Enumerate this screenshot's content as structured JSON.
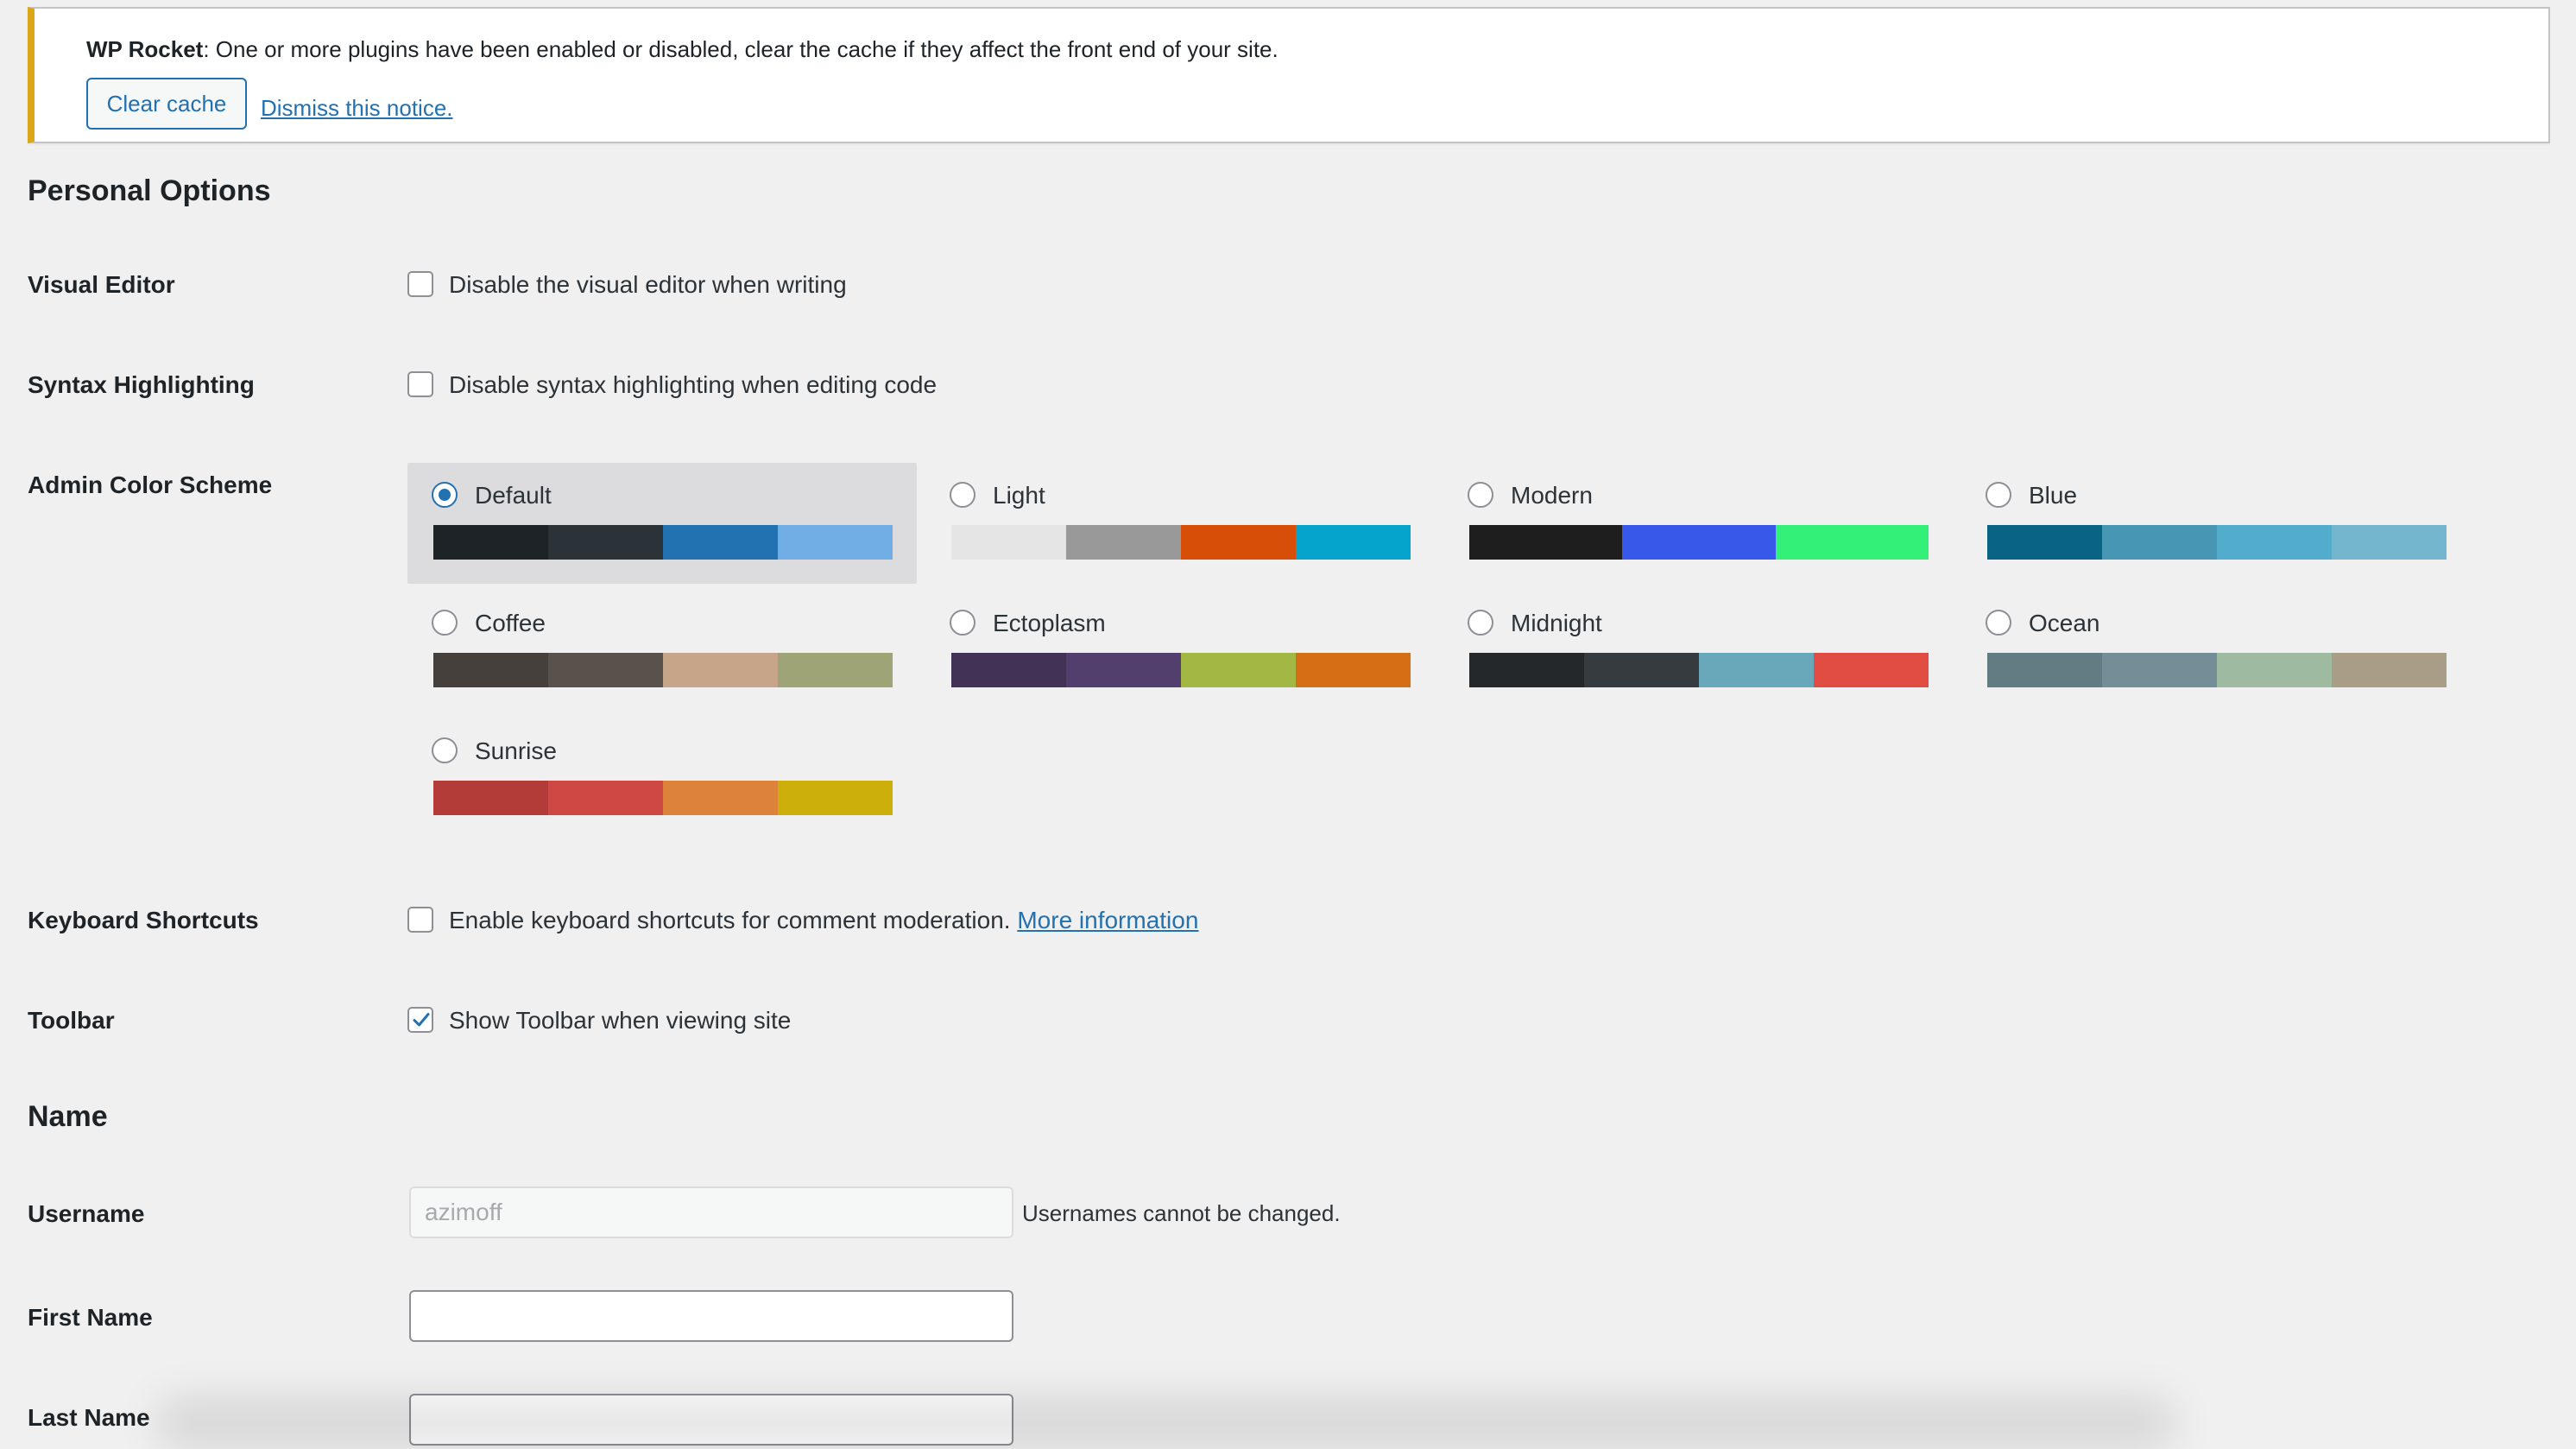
{
  "notice": {
    "brand": "WP Rocket",
    "message": ": One or more plugins have been enabled or disabled, clear the cache if they affect the front end of your site.",
    "clear_label": "Clear cache",
    "dismiss_label": "Dismiss this notice.",
    "accent_color": "#dba617"
  },
  "personal_options": {
    "title": "Personal Options",
    "visual_editor": {
      "label": "Visual Editor",
      "option": "Disable the visual editor when writing",
      "checked": false
    },
    "syntax_highlighting": {
      "label": "Syntax Highlighting",
      "option": "Disable syntax highlighting when editing code",
      "checked": false
    },
    "admin_color_scheme": {
      "label": "Admin Color Scheme",
      "selected": "Default",
      "schemes": [
        {
          "name": "Default",
          "colors": [
            "#1d2327",
            "#2c3338",
            "#2271b1",
            "#72aee6"
          ]
        },
        {
          "name": "Light",
          "colors": [
            "#e5e5e5",
            "#999999",
            "#d64e07",
            "#04a4cc"
          ]
        },
        {
          "name": "Modern",
          "colors": [
            "#1e1e1e",
            "#3858e9",
            "#33f078"
          ]
        },
        {
          "name": "Blue",
          "colors": [
            "#096484",
            "#4796b3",
            "#52accc",
            "#74b6ce"
          ]
        },
        {
          "name": "Coffee",
          "colors": [
            "#46403c",
            "#59524c",
            "#c7a589",
            "#9ea476"
          ]
        },
        {
          "name": "Ectoplasm",
          "colors": [
            "#413256",
            "#523f6d",
            "#a3b745",
            "#d46f15"
          ]
        },
        {
          "name": "Midnight",
          "colors": [
            "#25282b",
            "#363b3f",
            "#69a8bb",
            "#e14d43"
          ]
        },
        {
          "name": "Ocean",
          "colors": [
            "#627c83",
            "#738e96",
            "#9ebaa0",
            "#aa9d88"
          ]
        },
        {
          "name": "Sunrise",
          "colors": [
            "#b43c38",
            "#cf4944",
            "#dd823b",
            "#ccaf0b"
          ]
        }
      ]
    },
    "keyboard_shortcuts": {
      "label": "Keyboard Shortcuts",
      "option": "Enable keyboard shortcuts for comment moderation.",
      "link": "More information",
      "checked": false
    },
    "toolbar": {
      "label": "Toolbar",
      "option": "Show Toolbar when viewing site",
      "checked": true
    }
  },
  "name_section": {
    "title": "Name",
    "username": {
      "label": "Username",
      "value": "azimoff",
      "help": "Usernames cannot be changed."
    },
    "first_name": {
      "label": "First Name",
      "value": ""
    },
    "last_name": {
      "label": "Last Name",
      "value": ""
    }
  }
}
